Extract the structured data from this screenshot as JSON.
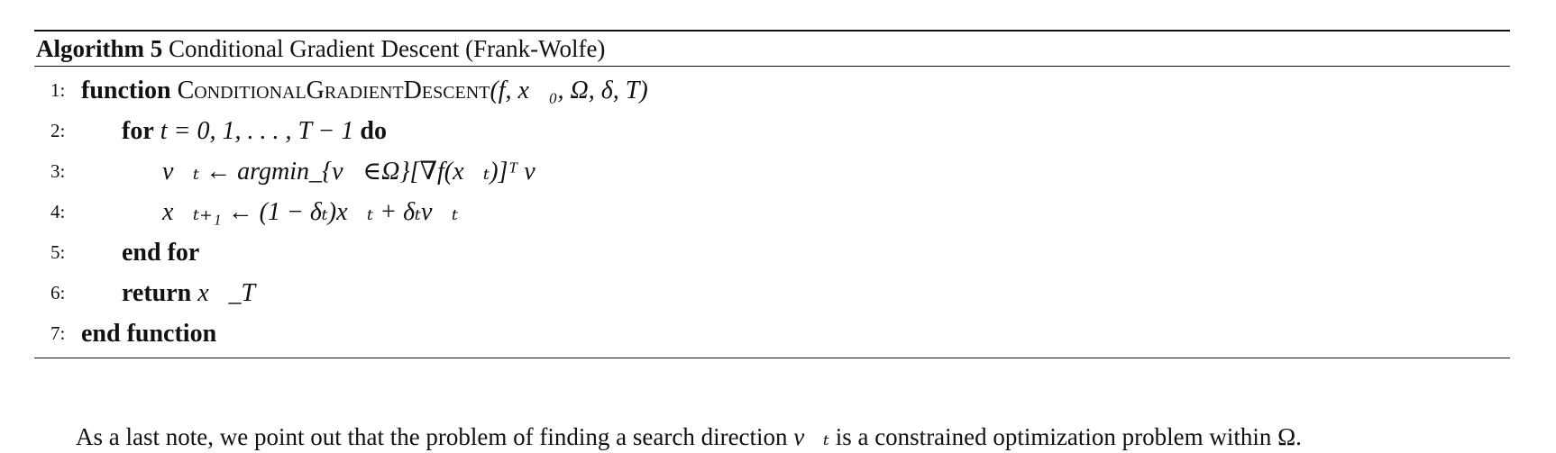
{
  "algorithm": {
    "label": "Algorithm 5",
    "title": "Conditional Gradient Descent (Frank-Wolfe)",
    "lines": [
      {
        "num": "1:",
        "keyword_start": "function",
        "text": "ConditionalGradientDescent",
        "math": "(f, x⃗₀, Ω, δ, T)",
        "keyword_end": ""
      },
      {
        "num": "2:",
        "keyword_start": "for",
        "text": "",
        "math": "t = 0, 1, . . . , T − 1",
        "keyword_end": "do"
      },
      {
        "num": "3:",
        "keyword_start": "",
        "text": "",
        "math": "v⃗ₜ ← argmin_{v⃗∈Ω}[∇f(x⃗ₜ)]ᵀ v⃗",
        "keyword_end": ""
      },
      {
        "num": "4:",
        "keyword_start": "",
        "text": "",
        "math": "x⃗ₜ₊₁ ← (1 − δₜ)x⃗ₜ + δₜv⃗ₜ",
        "keyword_end": ""
      },
      {
        "num": "5:",
        "keyword_start": "end for",
        "text": "",
        "math": "",
        "keyword_end": ""
      },
      {
        "num": "6:",
        "keyword_start": "return",
        "text": "",
        "math": "x⃗_T",
        "keyword_end": ""
      },
      {
        "num": "7:",
        "keyword_start": "end function",
        "text": "",
        "math": "",
        "keyword_end": ""
      }
    ]
  },
  "note": {
    "before": "As a last note, we point out that the problem of finding a search direction",
    "symbol": "v⃗ₜ",
    "after": "is a constrained optimization problem within Ω."
  }
}
